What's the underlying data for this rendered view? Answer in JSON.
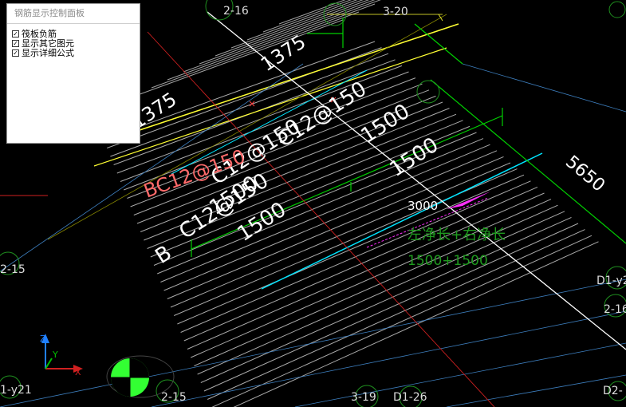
{
  "panel": {
    "title": "钢筋显示控制面板",
    "options": [
      {
        "label": "筏板负筋",
        "checked": true
      },
      {
        "label": "显示其它图元",
        "checked": true
      },
      {
        "label": "显示详细公式",
        "checked": true
      }
    ]
  },
  "drawing": {
    "axis_labels": {
      "a_2_16": "2-16",
      "a_3_20": "3-20",
      "a_2_15_left": "2-15",
      "a_2_15_bottom": "2-15",
      "a_3_19": "3-19",
      "a_d1_26": "D1-26",
      "a_d2": "D2-",
      "a_d1_y2": "D1-y2",
      "a_2_16_right": "2-16",
      "a_1_y21": "1-y21"
    },
    "grid_letter": "B",
    "dims": {
      "d1375_a": "1375",
      "d1375_b": "1375",
      "d1500_a": "1500",
      "d1500_b": "1500",
      "d1500_c": "1500",
      "d1500_d": "1500",
      "d5650": "5650",
      "d3000": "3000"
    },
    "rebar": {
      "c12_150_top": "C12@150",
      "c12_150_mid": "C12@150",
      "bc12_150": "BC12@150",
      "c12_150_left": "C12@150"
    },
    "formula_text": "左净长+右净长",
    "formula_values": "1500+1500",
    "ucs": {
      "y": "Y",
      "z": "Z",
      "x": "X"
    },
    "colors": {
      "background": "#000000",
      "rebar_lines": "#c8c8c8",
      "green": "#00d000",
      "yellow": "#ffff33",
      "cyan": "#00e5ff",
      "red": "#d02020",
      "magenta": "#ff30ff",
      "formula_green": "#1f9a1f",
      "bc_label": "#ff6a6a"
    }
  }
}
